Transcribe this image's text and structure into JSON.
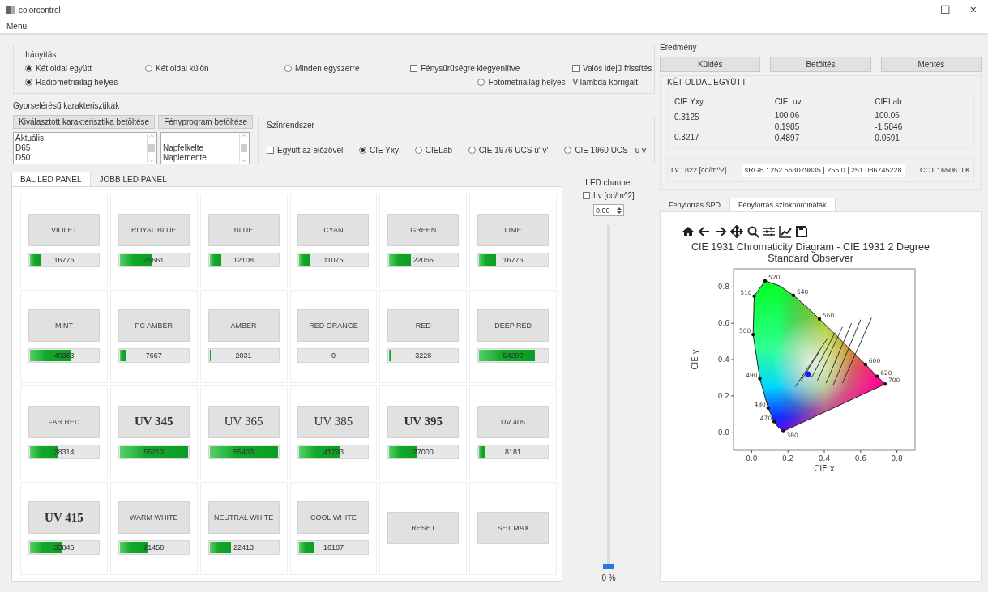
{
  "window": {
    "title": "colorcontrol",
    "controls": [
      "–",
      "☐",
      "×"
    ]
  },
  "menu": [
    "Menu"
  ],
  "control_group": {
    "title": "Irányítás",
    "row1": [
      {
        "kind": "radio",
        "label": "Két oldal együtt",
        "selected": true
      },
      {
        "kind": "radio",
        "label": "Két oldal külön",
        "selected": false
      },
      {
        "kind": "radio",
        "label": "Minden egyszerre",
        "selected": false
      },
      {
        "kind": "checkbox",
        "label": "Fénysűrűségre kiegyenlítve",
        "checked": false
      },
      {
        "kind": "checkbox",
        "label": "Valós idejű frissítés",
        "checked": false
      }
    ],
    "row2": [
      {
        "kind": "radio",
        "label": "Radiometriailag helyes",
        "selected": true
      },
      {
        "kind": "radio",
        "label": "Fotometriailag helyes - V-lambda korrigált",
        "selected": false
      }
    ]
  },
  "quick_group": {
    "title": "Gyorselérésű karakterisztikák",
    "buttons": [
      "Kiválasztott karakterisztika betöltése",
      "Fényprogram betöltése"
    ],
    "lists": [
      [
        "Aktuális",
        "D65",
        "D50"
      ],
      [
        "Napfelkelte",
        "Naplemente"
      ]
    ]
  },
  "color_system": {
    "title": "Színrendszer",
    "options": [
      {
        "kind": "checkbox",
        "label": "Együtt az előzővel",
        "checked": false
      },
      {
        "kind": "radio",
        "label": "CIE Yxy",
        "selected": true
      },
      {
        "kind": "radio",
        "label": "CIELab",
        "selected": false
      },
      {
        "kind": "radio",
        "label": "CIE 1976 UCS u' v'",
        "selected": false
      },
      {
        "kind": "radio",
        "label": "CIE 1960 UCS - u v",
        "selected": false
      }
    ]
  },
  "led_tabs": [
    {
      "label": "BAL LED PANEL",
      "selected": true
    },
    {
      "label": "JOBB LED PANEL",
      "selected": false
    }
  ],
  "leds": [
    {
      "kind": "plain",
      "name": "VIOLET",
      "value": "16776",
      "level": 0.17
    },
    {
      "kind": "plain",
      "name": "ROYAL BLUE",
      "value": "25661",
      "level": 0.47
    },
    {
      "kind": "plain",
      "name": "BLUE",
      "value": "12108",
      "level": 0.17
    },
    {
      "kind": "plain",
      "name": "CYAN",
      "value": "11075",
      "level": 0.16
    },
    {
      "kind": "plain",
      "name": "GREEN",
      "value": "22065",
      "level": 0.32
    },
    {
      "kind": "plain",
      "name": "LIME",
      "value": "16776",
      "level": 0.25
    },
    {
      "kind": "plain",
      "name": "MINT",
      "value": "40363",
      "level": 0.6
    },
    {
      "kind": "plain",
      "name": "PC AMBER",
      "value": "7667",
      "level": 0.1
    },
    {
      "kind": "plain",
      "name": "AMBER",
      "value": "2031",
      "level": 0.02
    },
    {
      "kind": "plain",
      "name": "RED ORANGE",
      "value": "0"
    },
    {
      "kind": "plain",
      "name": "RED",
      "value": "3228",
      "level": 0.03
    },
    {
      "kind": "plain",
      "name": "DEEP RED",
      "value": "54292",
      "level": 0.82
    },
    {
      "kind": "plain",
      "name": "FAR RED",
      "value": "28314",
      "level": 0.4
    },
    {
      "kind": "serif-bold",
      "name": "UV 345",
      "value": "55213",
      "level": 1
    },
    {
      "kind": "serif",
      "name": "UV 365",
      "value": "55403",
      "level": 1
    },
    {
      "kind": "serif",
      "name": "UV 385",
      "value": "41793",
      "level": 0.6
    },
    {
      "kind": "serif-bold",
      "name": "UV 395",
      "value": "27000",
      "level": 0.4
    },
    {
      "kind": "plain",
      "name": "UV 405",
      "value": "8181",
      "level": 0.1
    },
    {
      "kind": "serif-bold",
      "name": "UV 415",
      "value": "33846",
      "level": 0.48
    },
    {
      "kind": "plain",
      "name": "WARM WHITE",
      "value": "21458",
      "level": 0.41
    },
    {
      "kind": "plain",
      "name": "NEUTRAL WHITE",
      "value": "22413",
      "level": 0.32
    },
    {
      "kind": "plain",
      "name": "COOL WHITE",
      "value": "16187",
      "level": 0.22
    },
    {
      "kind": "button",
      "name": "RESET"
    },
    {
      "kind": "button",
      "name": "SET MAX"
    }
  ],
  "led_channel": {
    "title": "LED channel",
    "checkbox": {
      "label": "Lv [cd/m^2]",
      "checked": false
    },
    "spin_value": "0.00",
    "level": 0,
    "reading": "0 %"
  },
  "result": {
    "title": "Eredmény",
    "buttons": [
      "Küldés",
      "Betöltés",
      "Mentés"
    ],
    "group_title": "KÉT OLDAL EGYÜTT",
    "columns": [
      {
        "title": "CIE Yxy",
        "values": [
          "0.3125",
          "0.3217"
        ]
      },
      {
        "title": "CIELuv",
        "values": [
          "100.06",
          "0.1985",
          "0.4897"
        ]
      },
      {
        "title": "CIELab",
        "values": [
          "100.06",
          "-1.5846",
          "0.0591"
        ]
      }
    ],
    "lv": "Lv : 822 [cd/m^2]",
    "srgb": "sRGB : 252.563079835 | 255.0 | 251.086745228",
    "cct": "CCT : 6506.0 K"
  },
  "plot_tabs": [
    {
      "label": "Fényforrás SPD",
      "selected": false
    },
    {
      "label": "Fényforrás színkoordináták",
      "selected": true
    }
  ],
  "chart_data": {
    "type": "scatter",
    "title": "CIE 1931 Chromaticity Diagram - CIE 1931 2 Degree Standard Observer",
    "xlabel": "CIE x",
    "ylabel": "CIE y",
    "xlim": [
      -0.1,
      0.9
    ],
    "ylim": [
      -0.1,
      0.9
    ],
    "xticks": [
      {
        "value": 0,
        "label": "0.0"
      },
      {
        "value": 0.2,
        "label": "0.2"
      },
      {
        "value": 0.4,
        "label": "0.4"
      },
      {
        "value": 0.6,
        "label": "0.6"
      },
      {
        "value": 0.8,
        "label": "0.8"
      }
    ],
    "yticks": [
      {
        "value": 0,
        "label": "0.0"
      },
      {
        "value": 0.2,
        "label": "0.2"
      },
      {
        "value": 0.4,
        "label": "0.4"
      },
      {
        "value": 0.6,
        "label": "0.6"
      },
      {
        "value": 0.8,
        "label": "0.8"
      }
    ],
    "x": [
      0.31
    ],
    "series": [
      {
        "color": "#1a1aff",
        "values": [
          0.32
        ]
      }
    ],
    "annotations": [
      "520",
      "540",
      "560",
      "600",
      "620",
      "700",
      "510",
      "500",
      "490",
      "480",
      "470",
      "380"
    ]
  }
}
